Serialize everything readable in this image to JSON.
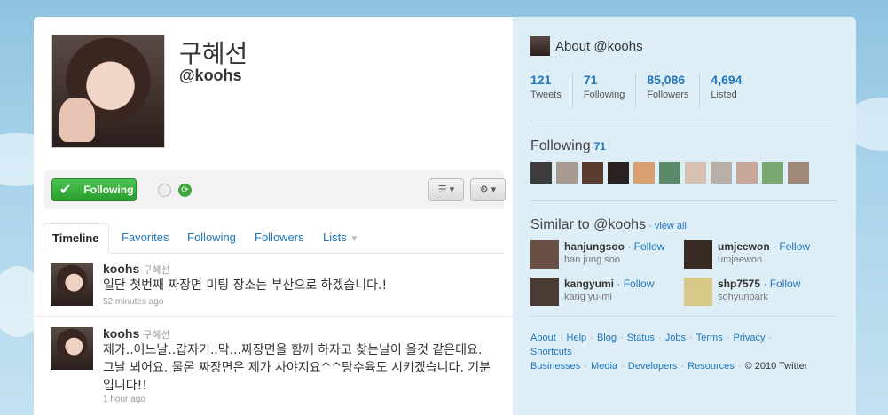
{
  "profile": {
    "name": "구혜선",
    "handle": "@koohs",
    "following_button": "Following"
  },
  "tabs": [
    "Timeline",
    "Favorites",
    "Following",
    "Followers",
    "Lists"
  ],
  "tweets": [
    {
      "user": "koohs",
      "realname": "구혜선",
      "text": "일단 첫번째 짜장면 미팅 장소는 부산으로 하겠습니다.!",
      "time": "52 minutes ago"
    },
    {
      "user": "koohs",
      "realname": "구혜선",
      "text": "제가..어느날..갑자기..막...짜장면을 함께 하자고 찾는날이 올것 같은데요. 그날 뵈어요. 물론 짜장면은 제가 사야지요^^탕수육도 시키겠습니다. 기분입니다!!",
      "time": "1 hour ago"
    }
  ],
  "sidebar": {
    "about_title": "About @koohs",
    "stats": [
      {
        "num": "121",
        "label": "Tweets"
      },
      {
        "num": "71",
        "label": "Following"
      },
      {
        "num": "85,086",
        "label": "Followers"
      },
      {
        "num": "4,694",
        "label": "Listed"
      }
    ],
    "following_title": "Following",
    "following_count": "71",
    "similar_title": "Similar to @koohs",
    "view_all": "view all",
    "follow_label": "Follow",
    "similar": [
      {
        "user": "hanjungsoo",
        "real": "han jung soo"
      },
      {
        "user": "umjeewon",
        "real": "umjeewon"
      },
      {
        "user": "kangyumi",
        "real": "kang yu-mi"
      },
      {
        "user": "shp7575",
        "real": "sohyunpark"
      }
    ],
    "footer_links": [
      "About",
      "Help",
      "Blog",
      "Status",
      "Jobs",
      "Terms",
      "Privacy",
      "Shortcuts",
      "Businesses",
      "Media",
      "Developers",
      "Resources"
    ],
    "copyright": "© 2010 Twitter"
  },
  "colors": {
    "link": "#2276bb",
    "following_green": "#2a9d2e",
    "background": "#a8d3ea",
    "sidebar": "#ddeef6"
  }
}
